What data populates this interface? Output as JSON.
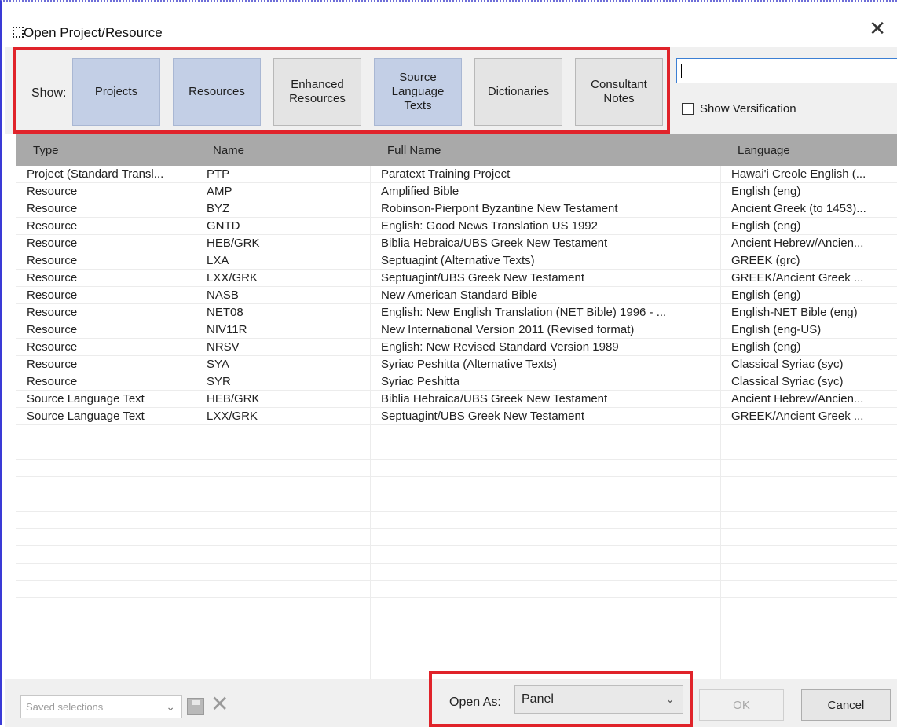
{
  "window": {
    "title": "Open Project/Resource",
    "close_glyph": "✕"
  },
  "toolbar": {
    "show_label": "Show:",
    "filters": [
      {
        "label": "Projects",
        "active": true
      },
      {
        "label": "Resources",
        "active": true
      },
      {
        "label": "Enhanced\nResources",
        "active": false
      },
      {
        "label": "Source\nLanguage\nTexts",
        "active": true
      },
      {
        "label": "Dictionaries",
        "active": false
      },
      {
        "label": "Consultant\nNotes",
        "active": false
      }
    ],
    "search_value": "",
    "show_verification_label": "Show Versification",
    "show_verification_checked": false
  },
  "grid": {
    "columns": [
      "Type",
      "Name",
      "Full Name",
      "Language"
    ],
    "rows": [
      [
        "Project (Standard Transl...",
        "PTP",
        "Paratext Training Project",
        "Hawai'i Creole English (..."
      ],
      [
        "Resource",
        "AMP",
        "Amplified Bible",
        "English (eng)"
      ],
      [
        "Resource",
        "BYZ",
        "Robinson-Pierpont Byzantine New Testament",
        "Ancient Greek (to 1453)..."
      ],
      [
        "Resource",
        "GNTD",
        "English: Good News Translation US 1992",
        "English (eng)"
      ],
      [
        "Resource",
        "HEB/GRK",
        "Biblia Hebraica/UBS Greek New Testament",
        "Ancient Hebrew/Ancien..."
      ],
      [
        "Resource",
        "LXA",
        "Septuagint (Alternative Texts)",
        "GREEK (grc)"
      ],
      [
        "Resource",
        "LXX/GRK",
        "Septuagint/UBS Greek New Testament",
        "GREEK/Ancient Greek ..."
      ],
      [
        "Resource",
        "NASB",
        "New American Standard Bible",
        "English (eng)"
      ],
      [
        "Resource",
        "NET08",
        "English: New English Translation (NET Bible) 1996 - ...",
        "English-NET Bible (eng)"
      ],
      [
        "Resource",
        "NIV11R",
        "New International Version 2011 (Revised format)",
        "English (eng-US)"
      ],
      [
        "Resource",
        "NRSV",
        "English: New Revised Standard Version 1989",
        "English (eng)"
      ],
      [
        "Resource",
        "SYA",
        "Syriac Peshitta (Alternative Texts)",
        "Classical Syriac (syc)"
      ],
      [
        "Resource",
        "SYR",
        "Syriac Peshitta",
        "Classical Syriac (syc)"
      ],
      [
        "Source Language Text",
        "HEB/GRK",
        "Biblia Hebraica/UBS Greek New Testament",
        "Ancient Hebrew/Ancien..."
      ],
      [
        "Source Language Text",
        "LXX/GRK",
        "Septuagint/UBS Greek New Testament",
        "GREEK/Ancient Greek ..."
      ]
    ]
  },
  "footer": {
    "saved_selections_placeholder": "Saved selections",
    "open_as_label": "Open As:",
    "open_as_value": "Panel",
    "ok_label": "OK",
    "cancel_label": "Cancel"
  },
  "colors": {
    "active_filter": "#c3cfe6",
    "highlight_box": "#e0232a",
    "header_bg": "#a9a9a9"
  }
}
